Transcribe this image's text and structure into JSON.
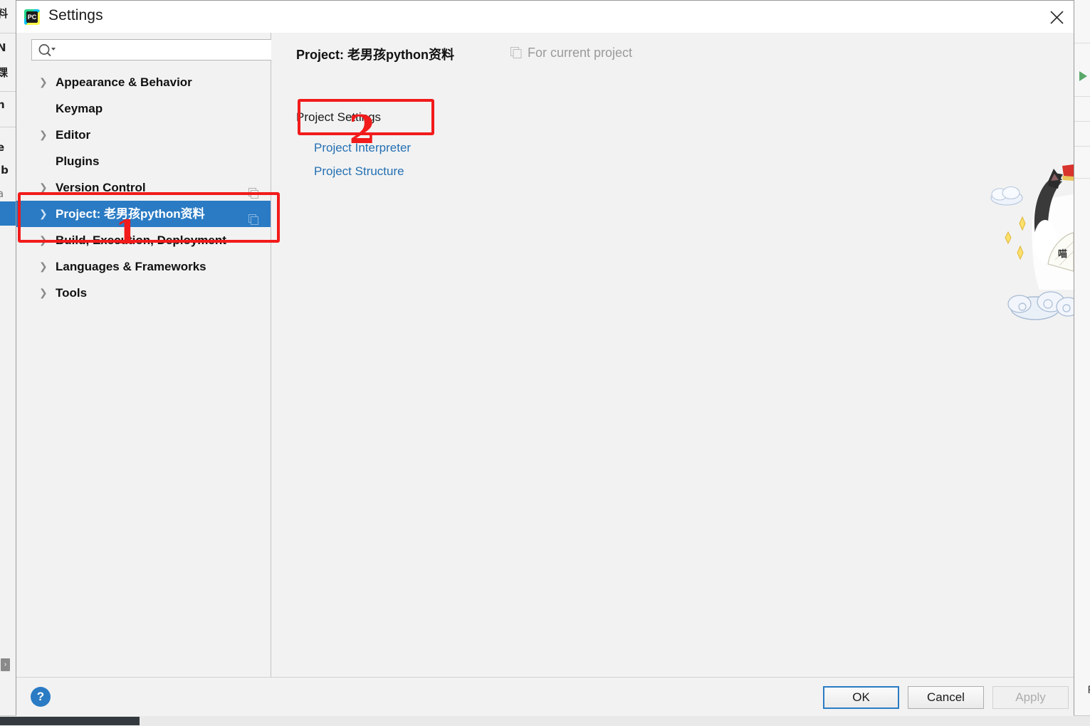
{
  "window": {
    "title": "Settings",
    "app_icon": "pycharm-logo-icon",
    "close_icon": "close-icon"
  },
  "search": {
    "value": "",
    "placeholder": "",
    "icon": "search-icon",
    "dropdown_icon": "chevron-down-icon"
  },
  "sidebar": {
    "items": [
      {
        "label": "Appearance & Behavior",
        "expandable": true,
        "selected": false,
        "badge": false
      },
      {
        "label": "Keymap",
        "expandable": false,
        "selected": false,
        "badge": false
      },
      {
        "label": "Editor",
        "expandable": true,
        "selected": false,
        "badge": false
      },
      {
        "label": "Plugins",
        "expandable": false,
        "selected": false,
        "badge": false
      },
      {
        "label": "Version Control",
        "expandable": true,
        "selected": false,
        "badge": true
      },
      {
        "label": "Project: 老男孩python资料",
        "expandable": true,
        "selected": true,
        "badge": true
      },
      {
        "label": "Build, Execution, Deployment",
        "expandable": true,
        "selected": false,
        "badge": false
      },
      {
        "label": "Languages & Frameworks",
        "expandable": true,
        "selected": false,
        "badge": false
      },
      {
        "label": "Tools",
        "expandable": true,
        "selected": false,
        "badge": false
      }
    ]
  },
  "content": {
    "title": "Project: 老男孩python资料",
    "for_current_project": "For current project",
    "for_current_icon": "copy-scope-icon",
    "section_label": "Project Settings",
    "links": [
      {
        "label": "Project Interpreter"
      },
      {
        "label": "Project Structure"
      }
    ]
  },
  "footer": {
    "help_label": "?",
    "ok_label": "OK",
    "cancel_label": "Cancel",
    "apply_label": "Apply",
    "apply_disabled": true
  },
  "annotations": {
    "step1": "1",
    "step2": "2",
    "color": "#f21b1b"
  },
  "background_ide": {
    "left_clipped_text": [
      "料",
      "N",
      "踝",
      "h",
      "e",
      "ib",
      "a"
    ],
    "right_clipped_text": [
      "P"
    ],
    "run_icon": "run-triangle-icon"
  },
  "colors": {
    "selection_blue": "#2a7bc4",
    "link_blue": "#2470b3",
    "annotation_red": "#f21b1b",
    "dialog_bg": "#f2f2f2",
    "titlebar_bg": "#ffffff",
    "muted_text": "#9a9a9a"
  }
}
